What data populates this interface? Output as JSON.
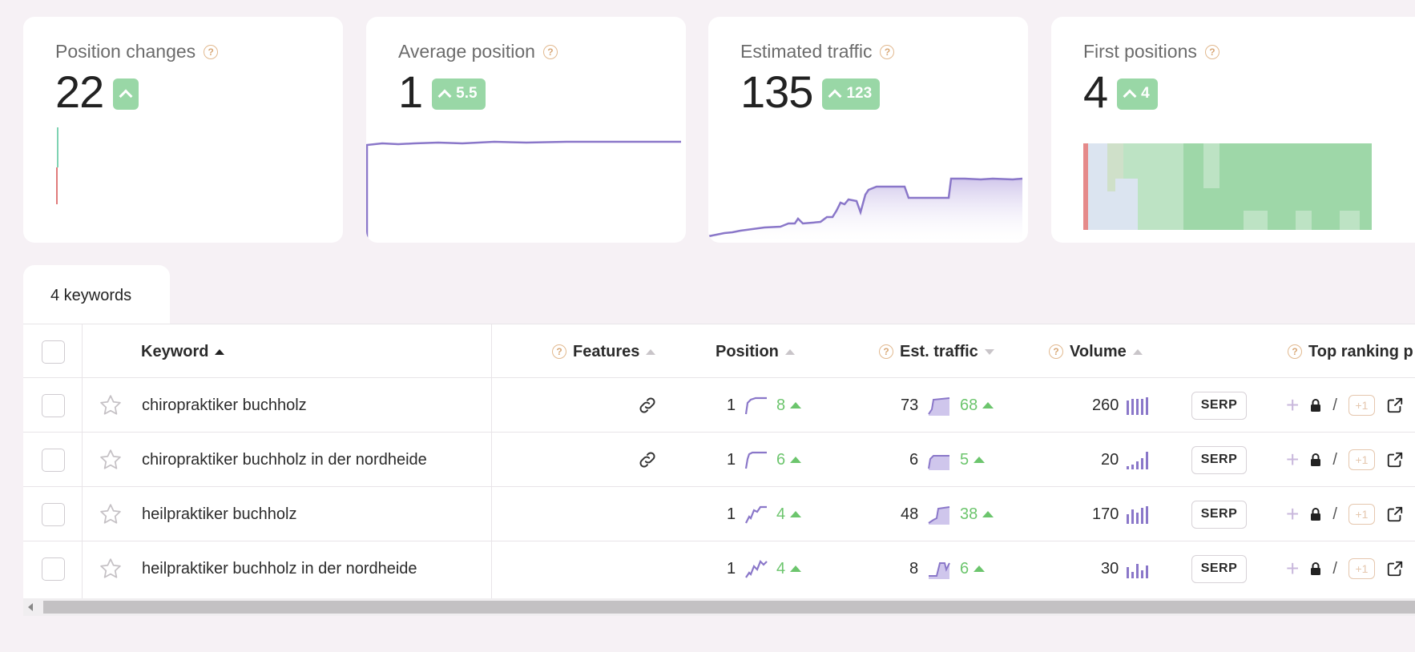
{
  "cards": [
    {
      "title": "Position changes",
      "value": "22",
      "delta": ""
    },
    {
      "title": "Average position",
      "value": "1",
      "delta": "5.5"
    },
    {
      "title": "Estimated traffic",
      "value": "135",
      "delta": "123"
    },
    {
      "title": "First positions",
      "value": "4",
      "delta": "4"
    }
  ],
  "tab": {
    "label": "4 keywords"
  },
  "table": {
    "headers": {
      "keyword": "Keyword",
      "features": "Features",
      "position": "Position",
      "est_traffic": "Est. traffic",
      "volume": "Volume",
      "top_ranking": "Top ranking p"
    },
    "serp_label": "SERP",
    "plus_one_label": "+1",
    "slash": "/",
    "rows": [
      {
        "keyword": "chiropraktiker buchholz",
        "has_link": true,
        "position": "1",
        "pos_change": "8",
        "traffic": "73",
        "traffic_change": "68",
        "volume": "260"
      },
      {
        "keyword": "chiropraktiker buchholz in der nordheide",
        "has_link": true,
        "position": "1",
        "pos_change": "6",
        "traffic": "6",
        "traffic_change": "5",
        "volume": "20"
      },
      {
        "keyword": "heilpraktiker buchholz",
        "has_link": false,
        "position": "1",
        "pos_change": "4",
        "traffic": "48",
        "traffic_change": "38",
        "volume": "170"
      },
      {
        "keyword": "heilpraktiker buchholz in der nordheide",
        "has_link": false,
        "position": "1",
        "pos_change": "4",
        "traffic": "8",
        "traffic_change": "6",
        "volume": "30"
      }
    ]
  },
  "colors": {
    "accent": "#8a77c9",
    "positive": "#6cc56d",
    "badge": "#99d7a6",
    "negative": "#e07b7b"
  }
}
